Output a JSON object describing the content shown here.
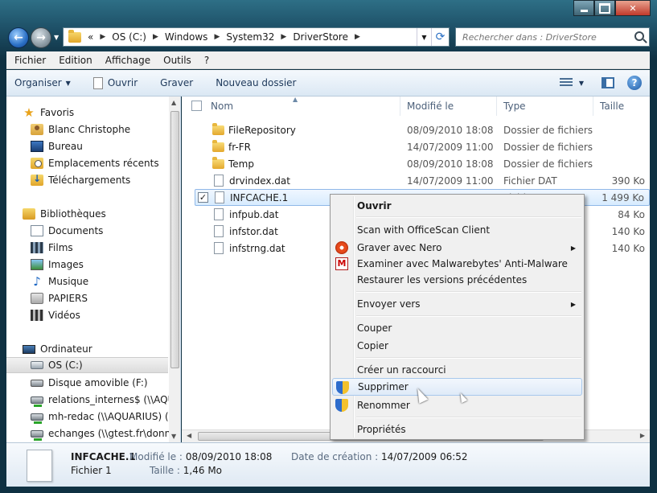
{
  "address": {
    "overflow": "«",
    "crumbs": [
      "OS (C:)",
      "Windows",
      "System32",
      "DriverStore"
    ]
  },
  "search": {
    "placeholder": "Rechercher dans : DriverStore"
  },
  "menubar": {
    "items": [
      "Fichier",
      "Edition",
      "Affichage",
      "Outils",
      "?"
    ]
  },
  "commandbar": {
    "organize": "Organiser",
    "open": "Ouvrir",
    "burn": "Graver",
    "new_folder": "Nouveau dossier"
  },
  "navpane": {
    "favorites": "Favoris",
    "fav_items": [
      "Blanc Christophe",
      "Bureau",
      "Emplacements récents",
      "Téléchargements"
    ],
    "libraries": "Bibliothèques",
    "lib_items": [
      "Documents",
      "Films",
      "Images",
      "Musique",
      "PAPIERS",
      "Vidéos"
    ],
    "computer": "Ordinateur",
    "comp_items": [
      "OS (C:)",
      "Disque amovible (F:)",
      "relations_internes$ (\\\\AQUA",
      "mh-redac (\\\\AQUARIUS) (N:",
      "echanges (\\\\gtest.fr\\donnee"
    ]
  },
  "columns": {
    "name": "Nom",
    "modified": "Modifié le",
    "type": "Type",
    "size": "Taille"
  },
  "files": [
    {
      "name": "FileRepository",
      "date": "08/09/2010 18:08",
      "type": "Dossier de fichiers",
      "size": "",
      "kind": "folder"
    },
    {
      "name": "fr-FR",
      "date": "14/07/2009 11:00",
      "type": "Dossier de fichiers",
      "size": "",
      "kind": "folder"
    },
    {
      "name": "Temp",
      "date": "08/09/2010 18:08",
      "type": "Dossier de fichiers",
      "size": "",
      "kind": "folder"
    },
    {
      "name": "drvindex.dat",
      "date": "14/07/2009 11:00",
      "type": "Fichier DAT",
      "size": "390 Ko",
      "kind": "file"
    },
    {
      "name": "INFCACHE.1",
      "date": "08/09/2010 18:08",
      "type": "Fichier 1",
      "size": "1 499 Ko",
      "kind": "file",
      "selected": true
    },
    {
      "name": "infpub.dat",
      "date": "",
      "type": "",
      "size": "84 Ko",
      "kind": "file"
    },
    {
      "name": "infstor.dat",
      "date": "",
      "type": "",
      "size": "140 Ko",
      "kind": "file"
    },
    {
      "name": "infstrng.dat",
      "date": "",
      "type": "",
      "size": "140 Ko",
      "kind": "file"
    }
  ],
  "context_menu": {
    "open": "Ouvrir",
    "scan": "Scan with OfficeScan Client",
    "nero": "Graver avec Nero",
    "malwarebytes": "Examiner avec Malwarebytes' Anti-Malware",
    "restore": "Restaurer les versions précédentes",
    "send_to": "Envoyer vers",
    "cut": "Couper",
    "copy": "Copier",
    "shortcut": "Créer un raccourci",
    "delete": "Supprimer",
    "rename": "Renommer",
    "properties": "Propriétés"
  },
  "details": {
    "filename": "INFCACHE.1",
    "filetype": "Fichier 1",
    "modified_label": "Modifié le :",
    "modified_value": "08/09/2010 18:08",
    "size_label": "Taille :",
    "size_value": "1,46 Mo",
    "created_label": "Date de création :",
    "created_value": "14/07/2009 06:52"
  },
  "colors": {
    "accent": "#1e395b",
    "selection": "#d7ebfe",
    "titlebar": "#0f3142"
  }
}
